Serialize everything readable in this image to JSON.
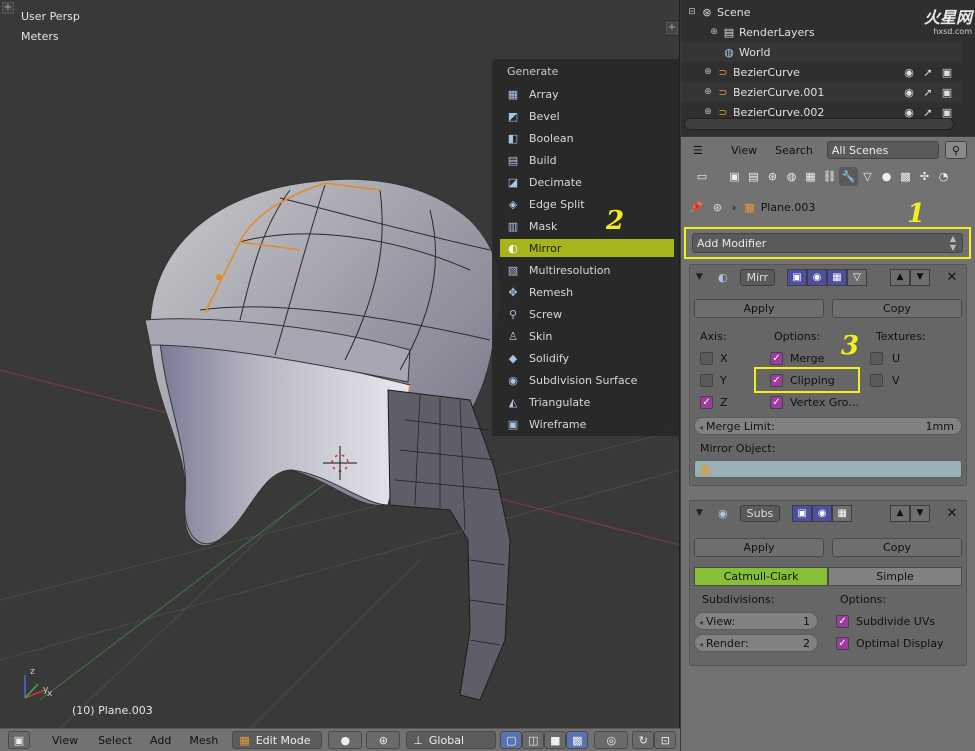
{
  "viewport": {
    "view_label": "User Persp",
    "units_label": "Meters",
    "object_label": "(10) Plane.003"
  },
  "generate_menu": {
    "title": "Generate",
    "items": [
      {
        "label": "Array",
        "icon": "array-icon"
      },
      {
        "label": "Bevel",
        "icon": "bevel-icon"
      },
      {
        "label": "Boolean",
        "icon": "boolean-icon"
      },
      {
        "label": "Build",
        "icon": "build-icon"
      },
      {
        "label": "Decimate",
        "icon": "decimate-icon"
      },
      {
        "label": "Edge Split",
        "icon": "edge-split-icon"
      },
      {
        "label": "Mask",
        "icon": "mask-icon"
      },
      {
        "label": "Mirror",
        "icon": "mirror-icon",
        "selected": true
      },
      {
        "label": "Multiresolution",
        "icon": "multires-icon"
      },
      {
        "label": "Remesh",
        "icon": "remesh-icon"
      },
      {
        "label": "Screw",
        "icon": "screw-icon"
      },
      {
        "label": "Skin",
        "icon": "skin-icon"
      },
      {
        "label": "Solidify",
        "icon": "solidify-icon"
      },
      {
        "label": "Subdivision Surface",
        "icon": "subsurf-icon"
      },
      {
        "label": "Triangulate",
        "icon": "triangulate-icon"
      },
      {
        "label": "Wireframe",
        "icon": "wireframe-icon"
      }
    ]
  },
  "bottom_bar": {
    "view": "View",
    "select": "Select",
    "add": "Add",
    "mesh": "Mesh",
    "mode": "Edit Mode",
    "orientation": "Global"
  },
  "outliner": {
    "rows": [
      {
        "label": "Scene",
        "icon": "scene-icon"
      },
      {
        "label": "RenderLayers",
        "icon": "render-layers-icon"
      },
      {
        "label": "World",
        "icon": "world-icon"
      },
      {
        "label": "BezierCurve",
        "icon": "curve-icon"
      },
      {
        "label": "BezierCurve.001",
        "icon": "curve-icon"
      },
      {
        "label": "BezierCurve.002",
        "icon": "curve-icon"
      }
    ],
    "header": {
      "view": "View",
      "search": "Search",
      "scenes_select": "All Scenes"
    }
  },
  "watermark": {
    "brand": "火星网",
    "url": "hxsd.com"
  },
  "properties": {
    "context_object": "Plane.003",
    "add_modifier": "Add Modifier",
    "mirror": {
      "name": "Mirr",
      "apply": "Apply",
      "copy": "Copy",
      "axis_label": "Axis:",
      "options_label": "Options:",
      "textures_label": "Textures:",
      "axis_x": "X",
      "axis_y": "Y",
      "axis_z": "Z",
      "merge": "Merge",
      "clipping": "Clipping",
      "vertex_groups": "Vertex Gro...",
      "tex_u": "U",
      "tex_v": "V",
      "merge_limit_label": "Merge Limit:",
      "merge_limit_value": "1mm",
      "mirror_object_label": "Mirror Object:"
    },
    "subsurf": {
      "name": "Subs",
      "apply": "Apply",
      "copy": "Copy",
      "catmull": "Catmull-Clark",
      "simple": "Simple",
      "subdivisions_label": "Subdivisions:",
      "options_label": "Options:",
      "view_label": "View:",
      "view_value": "1",
      "render_label": "Render:",
      "render_value": "2",
      "subdivide_uvs": "Subdivide UVs",
      "optimal_display": "Optimal Display"
    }
  },
  "annotations": {
    "step1": "1",
    "step2": "2",
    "step3": "3"
  }
}
